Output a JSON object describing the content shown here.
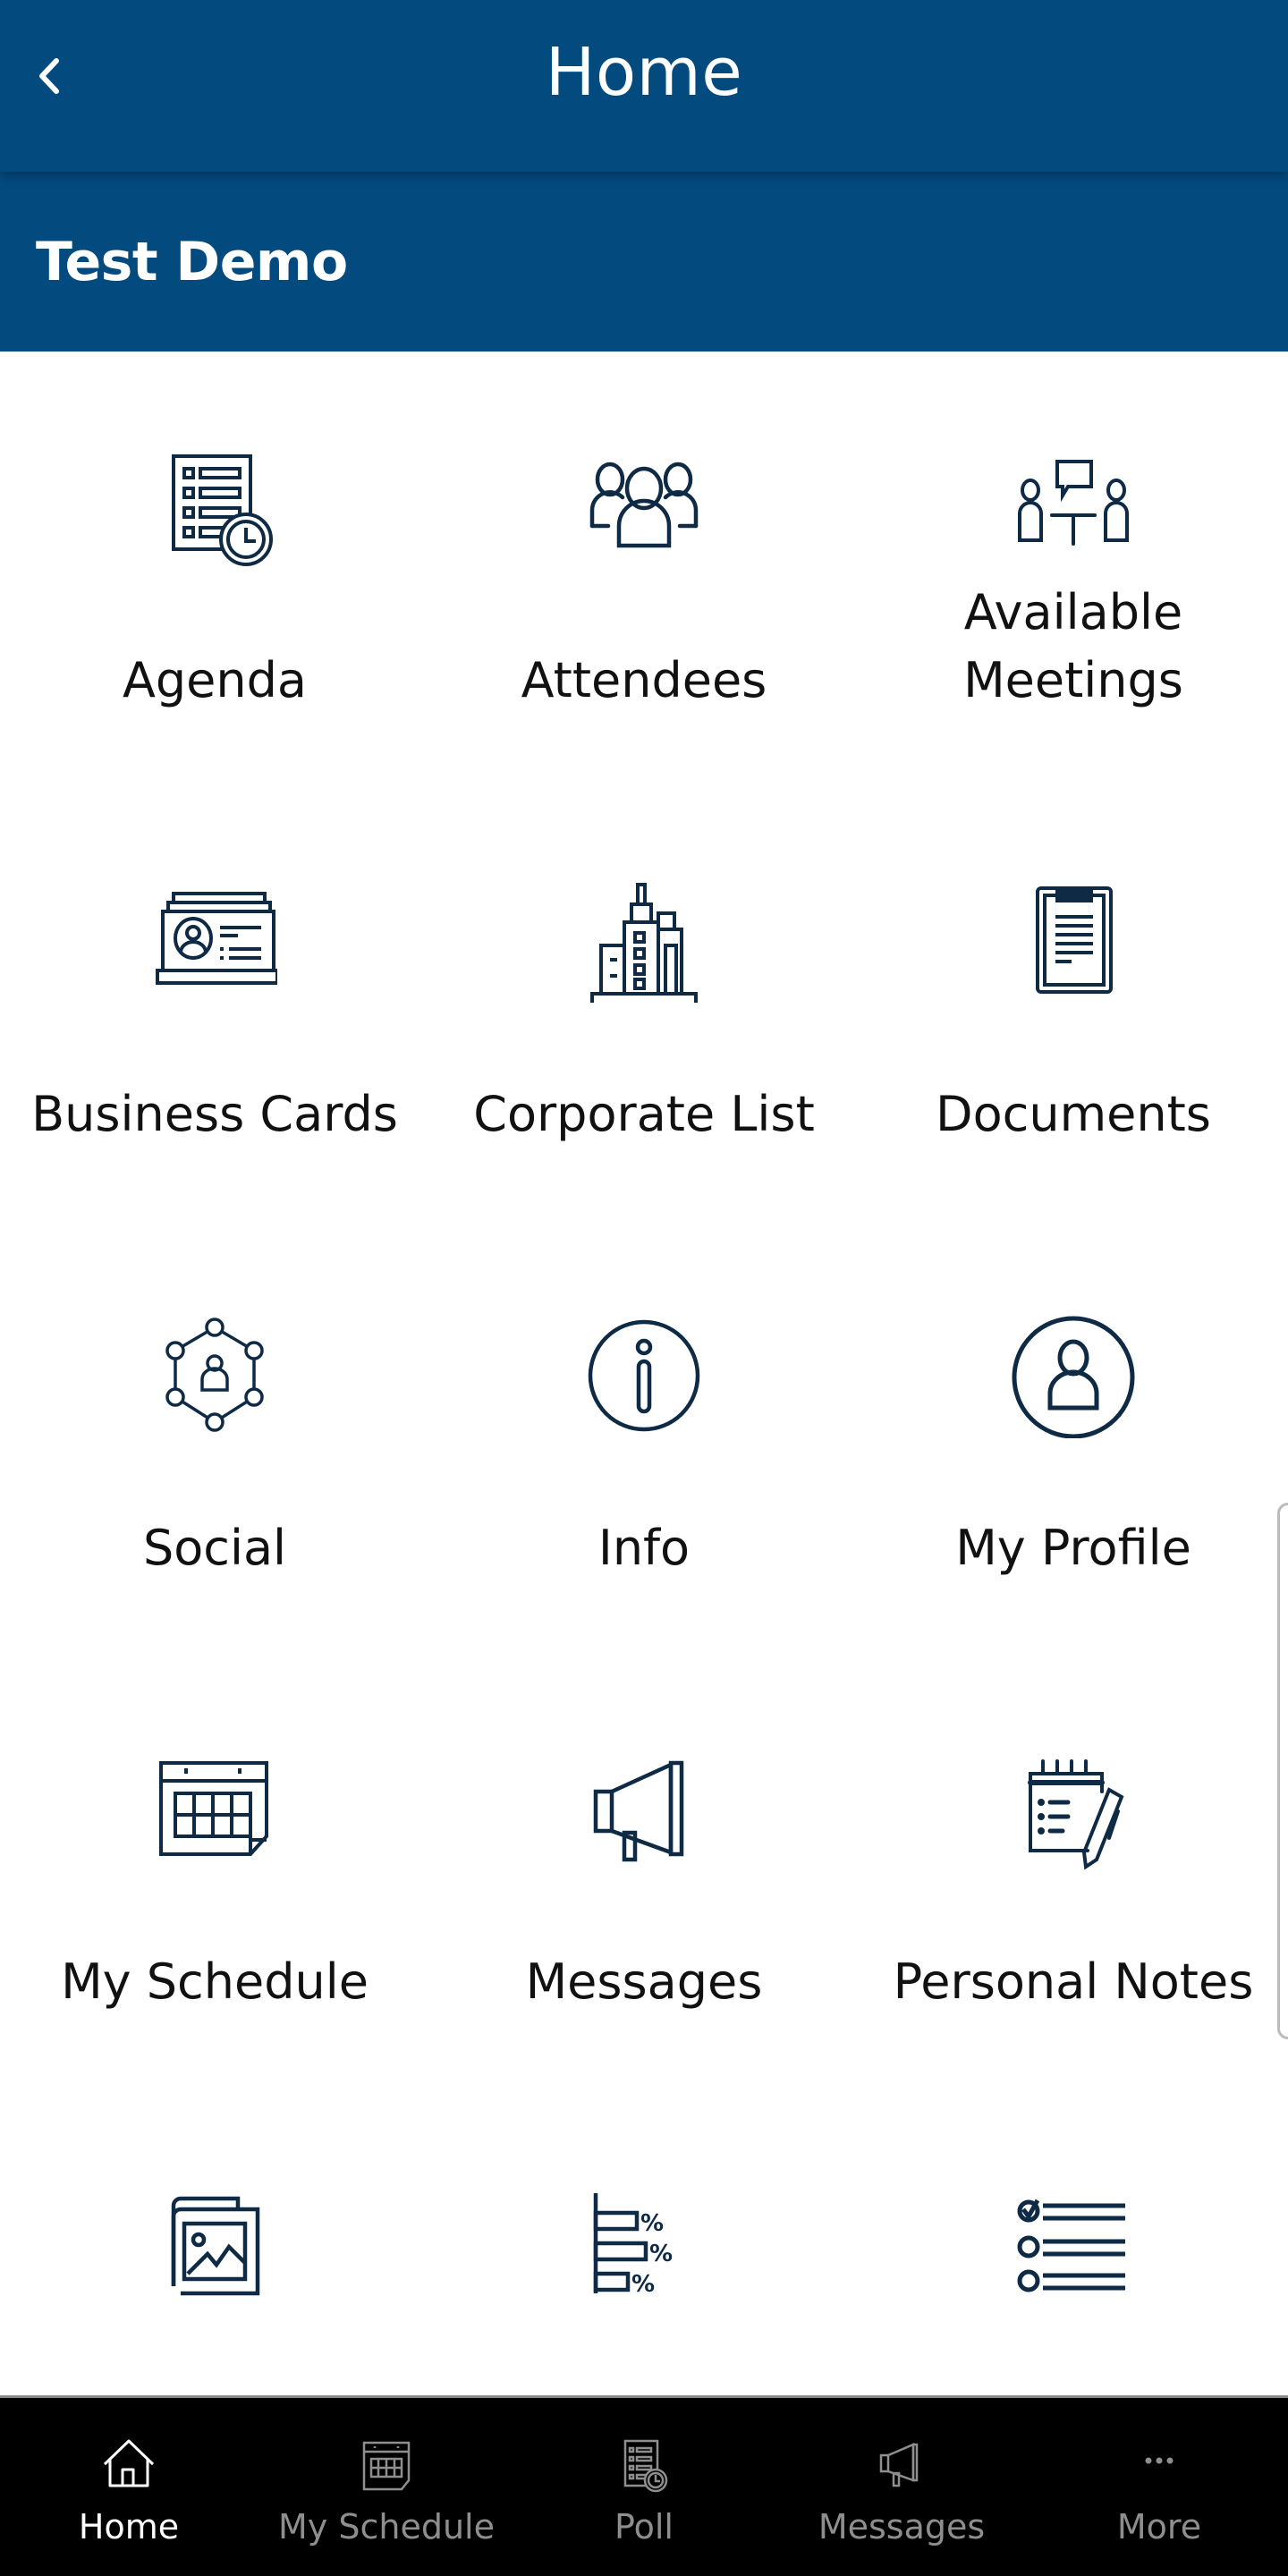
{
  "header": {
    "title": "Home",
    "back_icon": "chevron-left-icon",
    "background_color": "#034a7e"
  },
  "event": {
    "name": "Test Demo"
  },
  "grid": {
    "icon_color": "#0f2a45",
    "tiles": [
      {
        "label": "Agenda",
        "icon": "agenda-clock-icon"
      },
      {
        "label": "Attendees",
        "icon": "people-group-icon"
      },
      {
        "label": "Available Meetings",
        "label_lines": [
          "Available",
          "Meetings"
        ],
        "icon": "meeting-table-icon"
      },
      {
        "label": "Business Cards",
        "icon": "business-card-icon"
      },
      {
        "label": "Corporate List",
        "icon": "office-building-icon"
      },
      {
        "label": "Documents",
        "icon": "clipboard-document-icon"
      },
      {
        "label": "Social",
        "icon": "social-network-icon"
      },
      {
        "label": "Info",
        "icon": "info-circle-icon"
      },
      {
        "label": "My Profile",
        "icon": "profile-circle-icon"
      },
      {
        "label": "My Schedule",
        "icon": "calendar-icon"
      },
      {
        "label": "Messages",
        "icon": "megaphone-icon"
      },
      {
        "label": "Personal Notes",
        "icon": "notepad-pencil-icon"
      },
      {
        "label": "",
        "icon": "photo-gallery-icon"
      },
      {
        "label": "",
        "icon": "poll-percent-chart-icon"
      },
      {
        "label": "",
        "icon": "checklist-icon"
      }
    ]
  },
  "bottom_nav": {
    "items": [
      {
        "label": "Home",
        "icon": "home-icon",
        "active": true
      },
      {
        "label": "My Schedule",
        "icon": "calendar-icon",
        "active": false
      },
      {
        "label": "Poll",
        "icon": "agenda-clock-icon",
        "active": false
      },
      {
        "label": "Messages",
        "icon": "megaphone-icon",
        "active": false
      },
      {
        "label": "More",
        "icon": "more-dots-icon",
        "active": false
      }
    ],
    "active_color": "#ffffff",
    "inactive_color": "#8e8e8e"
  }
}
